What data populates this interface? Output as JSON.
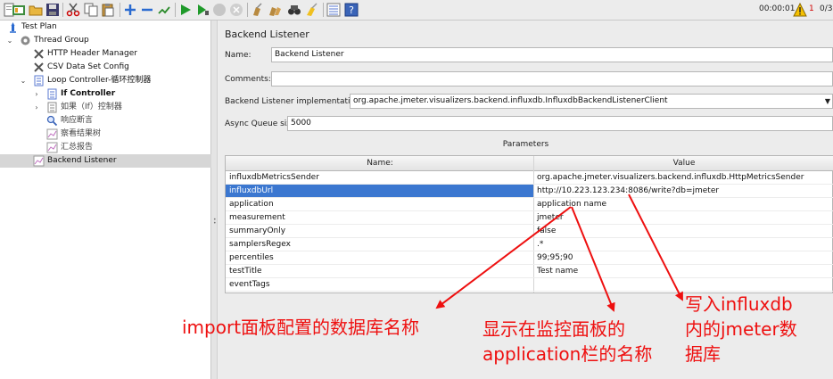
{
  "toolbar": {
    "timer": "00:00:01",
    "error_count": "1",
    "thread_count": "0/3",
    "icons": [
      "new-icon",
      "templates-icon",
      "open-icon",
      "save-icon",
      "cut-icon",
      "copy-icon",
      "paste-icon",
      "expand-icon",
      "collapse-icon",
      "toggle-icon",
      "start-icon",
      "start-no-pause-icon",
      "stop-icon",
      "shutdown-icon",
      "clear-icon",
      "clear-all-icon",
      "search-icon",
      "reset-search-icon",
      "function-helper-icon",
      "help-icon"
    ]
  },
  "tree": {
    "nodes": [
      {
        "label": "Test Plan"
      },
      {
        "label": "Thread Group"
      },
      {
        "label": "HTTP Header Manager"
      },
      {
        "label": "CSV Data Set Config"
      },
      {
        "label": "Loop Controller-循环控制器"
      },
      {
        "label": "If Controller"
      },
      {
        "label": "如果（If）控制器"
      },
      {
        "label": "响应断言"
      },
      {
        "label": "察看结果树"
      },
      {
        "label": "汇总报告"
      },
      {
        "label": "Backend Listener"
      }
    ]
  },
  "panel": {
    "title": "Backend Listener",
    "name_label": "Name:",
    "name_value": "Backend Listener",
    "comments_label": "Comments:",
    "comments_value": "",
    "impl_label": "Backend Listener implementation",
    "impl_value": "org.apache.jmeter.visualizers.backend.influxdb.InfluxdbBackendListenerClient",
    "queue_label": "Async Queue size",
    "queue_value": "5000",
    "params_title": "Parameters",
    "col_name": "Name:",
    "col_value": "Value",
    "rows": [
      {
        "name": "influxdbMetricsSender",
        "value": "org.apache.jmeter.visualizers.backend.influxdb.HttpMetricsSender"
      },
      {
        "name": "influxdbUrl",
        "value": "http://10.223.123.234:8086/write?db=jmeter"
      },
      {
        "name": "application",
        "value": "application name"
      },
      {
        "name": "measurement",
        "value": "jmeter"
      },
      {
        "name": "summaryOnly",
        "value": "false"
      },
      {
        "name": "samplersRegex",
        "value": ".*"
      },
      {
        "name": "percentiles",
        "value": "99;95;90"
      },
      {
        "name": "testTitle",
        "value": "Test name"
      },
      {
        "name": "eventTags",
        "value": ""
      }
    ]
  },
  "annotations": {
    "a1": "import面板配置的数据库名称",
    "a2_line1": "显示在监控面板的",
    "a2_line2": "application栏的名称",
    "a3_line1": "写入influxdb",
    "a3_line2": "内的jmeter数",
    "a3_line3": "据库",
    "color": "#ee1010"
  },
  "colors": {
    "selection": "#3b77d0",
    "tree_selection": "#d6d6d6",
    "error": "#d00000"
  }
}
